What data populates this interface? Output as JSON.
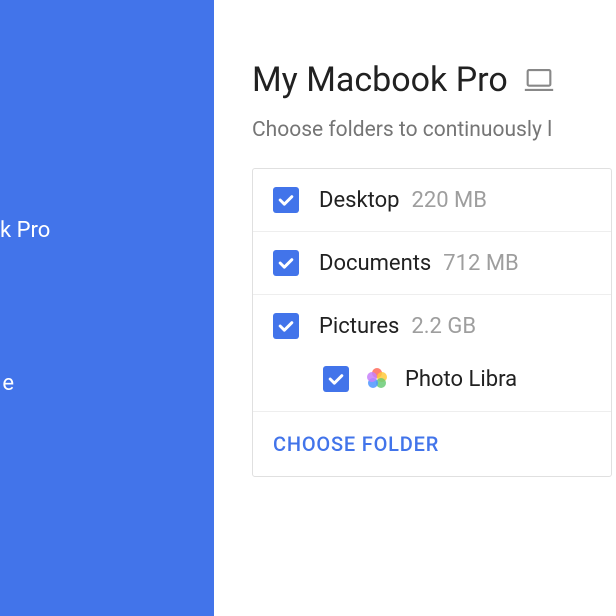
{
  "sidebar": {
    "items": [
      {
        "label": "k Pro"
      },
      {
        "label": "e"
      }
    ]
  },
  "header": {
    "title": "My Macbook Pro",
    "subtitle": "Choose folders to continuously l"
  },
  "folders": {
    "items": [
      {
        "name": "Desktop",
        "size": "220 MB",
        "checked": true
      },
      {
        "name": "Documents",
        "size": "712 MB",
        "checked": true
      },
      {
        "name": "Pictures",
        "size": "2.2 GB",
        "checked": true
      }
    ],
    "subitem": {
      "name": "Photo Libra",
      "checked": true
    }
  },
  "actions": {
    "choose_folder": "CHOOSE FOLDER"
  },
  "colors": {
    "primary": "#4274ea",
    "text_secondary": "#757575"
  }
}
